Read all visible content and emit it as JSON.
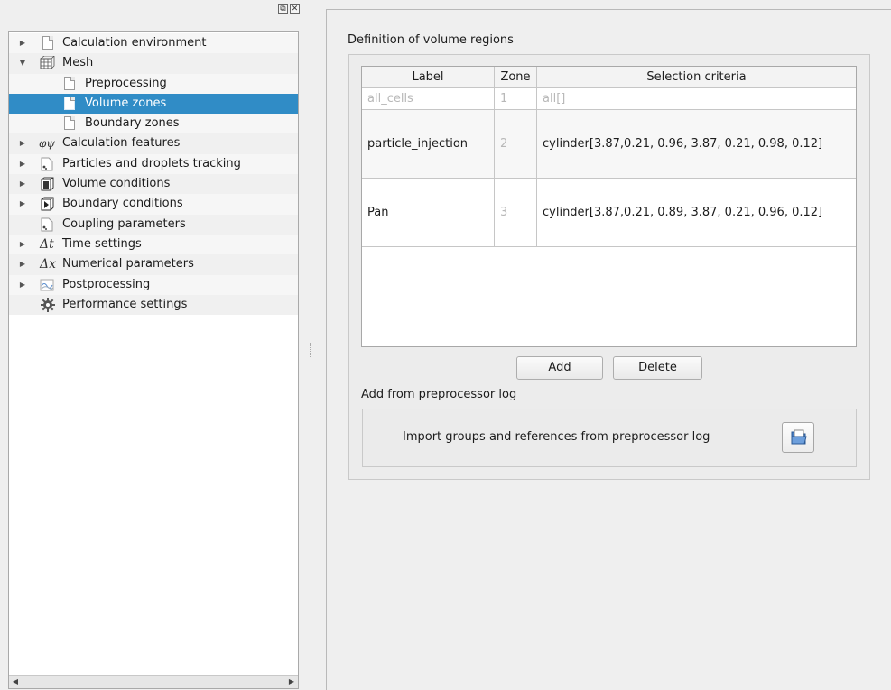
{
  "dock": {
    "float_glyph": "⧉",
    "close_glyph": "✕"
  },
  "tree": {
    "items": [
      {
        "label": "Calculation environment",
        "icon": "page-icon",
        "expandable": true,
        "expanded": false,
        "indent": 0
      },
      {
        "label": "Mesh",
        "icon": "mesh-icon",
        "expandable": true,
        "expanded": true,
        "indent": 0
      },
      {
        "label": "Preprocessing",
        "icon": "page-icon",
        "expandable": false,
        "indent": 1
      },
      {
        "label": "Volume zones",
        "icon": "page-icon",
        "expandable": false,
        "indent": 1,
        "selected": true
      },
      {
        "label": "Boundary zones",
        "icon": "page-icon",
        "expandable": false,
        "indent": 1
      },
      {
        "label": "Calculation features",
        "icon": "phi-psi-icon",
        "expandable": true,
        "expanded": false,
        "indent": 0
      },
      {
        "label": "Particles and droplets tracking",
        "icon": "particles-page-icon",
        "expandable": true,
        "expanded": false,
        "indent": 0
      },
      {
        "label": "Volume conditions",
        "icon": "volume-cube-icon",
        "expandable": true,
        "expanded": false,
        "indent": 0
      },
      {
        "label": "Boundary conditions",
        "icon": "boundary-cube-icon",
        "expandable": true,
        "expanded": false,
        "indent": 0
      },
      {
        "label": "Coupling parameters",
        "icon": "coupling-page-icon",
        "expandable": false,
        "indent": 0
      },
      {
        "label": "Time settings",
        "icon": "delta-t-icon",
        "expandable": true,
        "expanded": false,
        "indent": 0
      },
      {
        "label": "Numerical parameters",
        "icon": "delta-x-icon",
        "expandable": true,
        "expanded": false,
        "indent": 0
      },
      {
        "label": "Postprocessing",
        "icon": "chart-icon",
        "expandable": true,
        "expanded": false,
        "indent": 0
      },
      {
        "label": "Performance settings",
        "icon": "gear-icon",
        "expandable": false,
        "indent": 0
      }
    ],
    "glyphs": {
      "phi_psi": "φψ",
      "delta_t": "Δt",
      "delta_x": "Δx"
    }
  },
  "main": {
    "section_title": "Definition of volume regions",
    "table": {
      "columns": [
        "Label",
        "Zone",
        "Selection criteria"
      ],
      "rows": [
        {
          "label": "all_cells",
          "zone": "1",
          "criteria": "all[]",
          "dim": true
        },
        {
          "label": "particle_injection",
          "zone": "2",
          "criteria": "cylinder[3.87,0.21, 0.96, 3.87, 0.21, 0.98, 0.12]"
        },
        {
          "label": "Pan",
          "zone": "3",
          "criteria": "cylinder[3.87,0.21, 0.89, 3.87, 0.21, 0.96, 0.12]"
        }
      ]
    },
    "buttons": {
      "add": "Add",
      "delete": "Delete"
    },
    "preprocessor": {
      "title": "Add from preprocessor log",
      "import_label": "Import groups and references from preprocessor log",
      "import_icon": "folder-open-icon"
    }
  },
  "colors": {
    "selection": "#308cc6",
    "window_bg": "#efefef"
  }
}
